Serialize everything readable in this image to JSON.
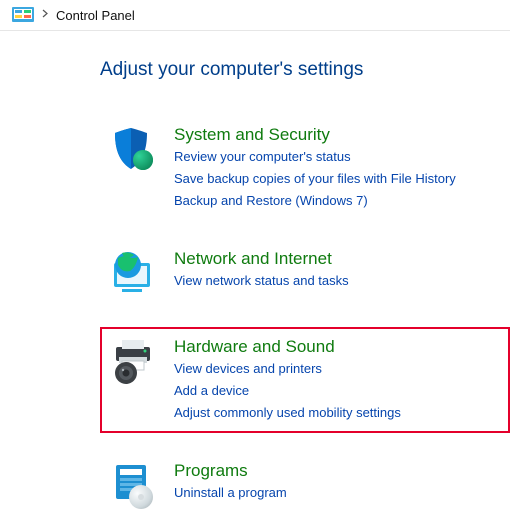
{
  "breadcrumb": {
    "location": "Control Panel"
  },
  "page_title": "Adjust your computer's settings",
  "categories": [
    {
      "icon": "shield-icon",
      "title": "System and Security",
      "links": [
        "Review your computer's status",
        "Save backup copies of your files with File History",
        "Backup and Restore (Windows 7)"
      ],
      "highlighted": false
    },
    {
      "icon": "globe-icon",
      "title": "Network and Internet",
      "links": [
        "View network status and tasks"
      ],
      "highlighted": false
    },
    {
      "icon": "printer-icon",
      "title": "Hardware and Sound",
      "links": [
        "View devices and printers",
        "Add a device",
        "Adjust commonly used mobility settings"
      ],
      "highlighted": true
    },
    {
      "icon": "programs-icon",
      "title": "Programs",
      "links": [
        "Uninstall a program"
      ],
      "highlighted": false
    }
  ]
}
